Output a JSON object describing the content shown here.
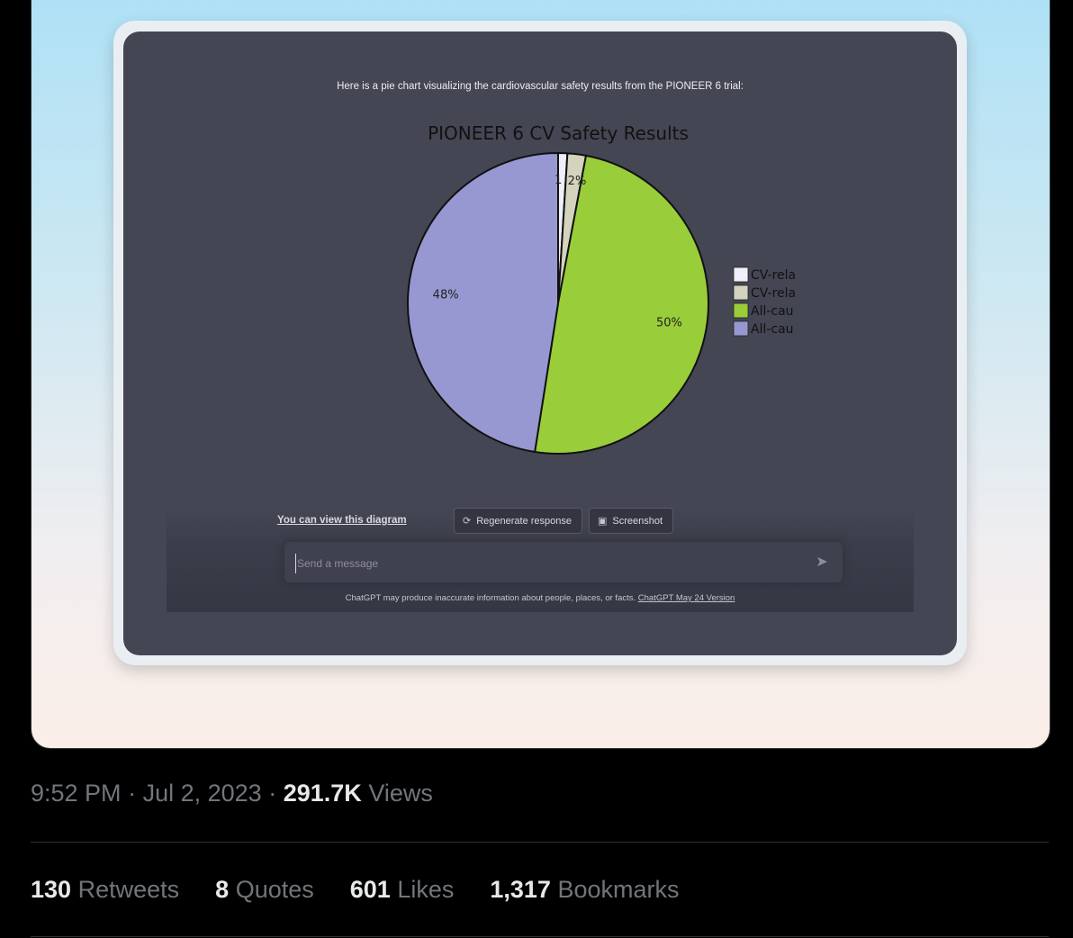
{
  "chat": {
    "intro": "Here is a pie chart visualizing the cardiovascular safety results from the PIONEER 6 trial:",
    "view_link": "You can view this diagram",
    "regenerate_label": "Regenerate response",
    "screenshot_label": "Screenshot",
    "input_placeholder": "Send a message",
    "disclaimer": "ChatGPT may produce inaccurate information about people, places, or facts.",
    "disclaimer_link": "ChatGPT May 24 Version"
  },
  "chart_data": {
    "type": "pie",
    "title": "PIONEER 6 CV Safety Results",
    "slices": [
      {
        "legend": "CV-rela",
        "value": 1,
        "label": "1",
        "color": "#f0eef8"
      },
      {
        "legend": "CV-rela",
        "value": 2,
        "label": "2%",
        "color": "#d4d3bd"
      },
      {
        "legend": "All-cau",
        "value": 50,
        "label": "50%",
        "color": "#9acd3a"
      },
      {
        "legend": "All-cau",
        "value": 48,
        "label": "48%",
        "color": "#9798d1"
      }
    ],
    "legend_placement": "right"
  },
  "tweet": {
    "time": "9:52 PM",
    "sep": "·",
    "date": "Jul 2, 2023",
    "views_count": "291.7K",
    "views_label": "Views",
    "retweets_count": "130",
    "retweets_label": "Retweets",
    "quotes_count": "8",
    "quotes_label": "Quotes",
    "likes_count": "601",
    "likes_label": "Likes",
    "bookmarks_count": "1,317",
    "bookmarks_label": "Bookmarks"
  }
}
